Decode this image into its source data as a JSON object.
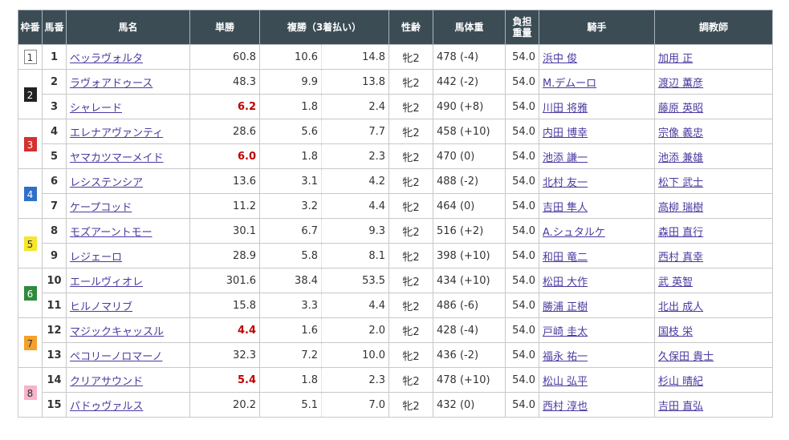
{
  "headers": {
    "waku": "枠番",
    "umaban": "馬番",
    "name": "馬名",
    "win": "単勝",
    "place": "複勝（3着払い）",
    "sex_age": "性齢",
    "weight": "馬体重",
    "burden_1": "負担",
    "burden_2": "重量",
    "jockey": "騎手",
    "trainer": "調教師"
  },
  "waku_colors": {
    "1": {
      "bg": "#ffffff",
      "fg": "#333333",
      "border": "#888888"
    },
    "2": {
      "bg": "#222222",
      "fg": "#ffffff",
      "border": "#222222"
    },
    "3": {
      "bg": "#d43030",
      "fg": "#ffffff",
      "border": "#d43030"
    },
    "4": {
      "bg": "#2f6fc9",
      "fg": "#ffffff",
      "border": "#2f6fc9"
    },
    "5": {
      "bg": "#f5e62a",
      "fg": "#333333",
      "border": "#f5e62a"
    },
    "6": {
      "bg": "#2f8a3a",
      "fg": "#ffffff",
      "border": "#2f8a3a"
    },
    "7": {
      "bg": "#f5a02a",
      "fg": "#333333",
      "border": "#f5a02a"
    },
    "8": {
      "bg": "#f6b4cb",
      "fg": "#333333",
      "border": "#f6b4cb"
    }
  },
  "groups": [
    {
      "waku": "1",
      "rows": [
        {
          "umaban": "1",
          "name": "ベッラヴォルタ",
          "win": "60.8",
          "fav": false,
          "place_lo": "10.6",
          "place_hi": "14.8",
          "sex_age": "牝2",
          "weight": "478 (-4)",
          "burden": "54.0",
          "jockey": "浜中 俊",
          "trainer": "加用 正"
        }
      ]
    },
    {
      "waku": "2",
      "rows": [
        {
          "umaban": "2",
          "name": "ラヴォアドゥース",
          "win": "48.3",
          "fav": false,
          "place_lo": "9.9",
          "place_hi": "13.8",
          "sex_age": "牝2",
          "weight": "442 (-2)",
          "burden": "54.0",
          "jockey": "M.デムーロ",
          "trainer": "渡辺 薫彦"
        },
        {
          "umaban": "3",
          "name": "シャレード",
          "win": "6.2",
          "fav": true,
          "place_lo": "1.8",
          "place_hi": "2.4",
          "sex_age": "牝2",
          "weight": "490 (+8)",
          "burden": "54.0",
          "jockey": "川田 将雅",
          "trainer": "藤原 英昭"
        }
      ]
    },
    {
      "waku": "3",
      "rows": [
        {
          "umaban": "4",
          "name": "エレナアヴァンティ",
          "win": "28.6",
          "fav": false,
          "place_lo": "5.6",
          "place_hi": "7.7",
          "sex_age": "牝2",
          "weight": "458 (+10)",
          "burden": "54.0",
          "jockey": "内田 博幸",
          "trainer": "宗像 義忠"
        },
        {
          "umaban": "5",
          "name": "ヤマカツマーメイド",
          "win": "6.0",
          "fav": true,
          "place_lo": "1.8",
          "place_hi": "2.3",
          "sex_age": "牝2",
          "weight": "470 (0)",
          "burden": "54.0",
          "jockey": "池添 謙一",
          "trainer": "池添 兼雄"
        }
      ]
    },
    {
      "waku": "4",
      "rows": [
        {
          "umaban": "6",
          "name": "レシステンシア",
          "win": "13.6",
          "fav": false,
          "place_lo": "3.1",
          "place_hi": "4.2",
          "sex_age": "牝2",
          "weight": "488 (-2)",
          "burden": "54.0",
          "jockey": "北村 友一",
          "trainer": "松下 武士"
        },
        {
          "umaban": "7",
          "name": "ケープコッド",
          "win": "11.2",
          "fav": false,
          "place_lo": "3.2",
          "place_hi": "4.4",
          "sex_age": "牝2",
          "weight": "464 (0)",
          "burden": "54.0",
          "jockey": "吉田 隼人",
          "trainer": "高柳 瑞樹"
        }
      ]
    },
    {
      "waku": "5",
      "rows": [
        {
          "umaban": "8",
          "name": "モズアーントモー",
          "win": "30.1",
          "fav": false,
          "place_lo": "6.7",
          "place_hi": "9.3",
          "sex_age": "牝2",
          "weight": "516 (+2)",
          "burden": "54.0",
          "jockey": "A.シュタルケ",
          "trainer": "森田 直行"
        },
        {
          "umaban": "9",
          "name": "レジェーロ",
          "win": "28.9",
          "fav": false,
          "place_lo": "5.8",
          "place_hi": "8.1",
          "sex_age": "牝2",
          "weight": "398 (+10)",
          "burden": "54.0",
          "jockey": "和田 竜二",
          "trainer": "西村 真幸"
        }
      ]
    },
    {
      "waku": "6",
      "rows": [
        {
          "umaban": "10",
          "name": "エールヴィオレ",
          "win": "301.6",
          "fav": false,
          "place_lo": "38.4",
          "place_hi": "53.5",
          "sex_age": "牝2",
          "weight": "434 (+10)",
          "burden": "54.0",
          "jockey": "松田 大作",
          "trainer": "武 英智"
        },
        {
          "umaban": "11",
          "name": "ヒルノマリブ",
          "win": "15.8",
          "fav": false,
          "place_lo": "3.3",
          "place_hi": "4.4",
          "sex_age": "牝2",
          "weight": "486 (-6)",
          "burden": "54.0",
          "jockey": "勝浦 正樹",
          "trainer": "北出 成人"
        }
      ]
    },
    {
      "waku": "7",
      "rows": [
        {
          "umaban": "12",
          "name": "マジックキャッスル",
          "win": "4.4",
          "fav": true,
          "place_lo": "1.6",
          "place_hi": "2.0",
          "sex_age": "牝2",
          "weight": "428 (-4)",
          "burden": "54.0",
          "jockey": "戸崎 圭太",
          "trainer": "国枝 栄"
        },
        {
          "umaban": "13",
          "name": "ペコリーノロマーノ",
          "win": "32.3",
          "fav": false,
          "place_lo": "7.2",
          "place_hi": "10.0",
          "sex_age": "牝2",
          "weight": "436 (-2)",
          "burden": "54.0",
          "jockey": "福永 祐一",
          "trainer": "久保田 貴士"
        }
      ]
    },
    {
      "waku": "8",
      "rows": [
        {
          "umaban": "14",
          "name": "クリアサウンド",
          "win": "5.4",
          "fav": true,
          "place_lo": "1.8",
          "place_hi": "2.3",
          "sex_age": "牝2",
          "weight": "478 (+10)",
          "burden": "54.0",
          "jockey": "松山 弘平",
          "trainer": "杉山 晴紀"
        },
        {
          "umaban": "15",
          "name": "パドゥヴァルス",
          "win": "20.2",
          "fav": false,
          "place_lo": "5.1",
          "place_hi": "7.0",
          "sex_age": "牝2",
          "weight": "432 (0)",
          "burden": "54.0",
          "jockey": "西村 淳也",
          "trainer": "吉田 直弘"
        }
      ]
    }
  ]
}
